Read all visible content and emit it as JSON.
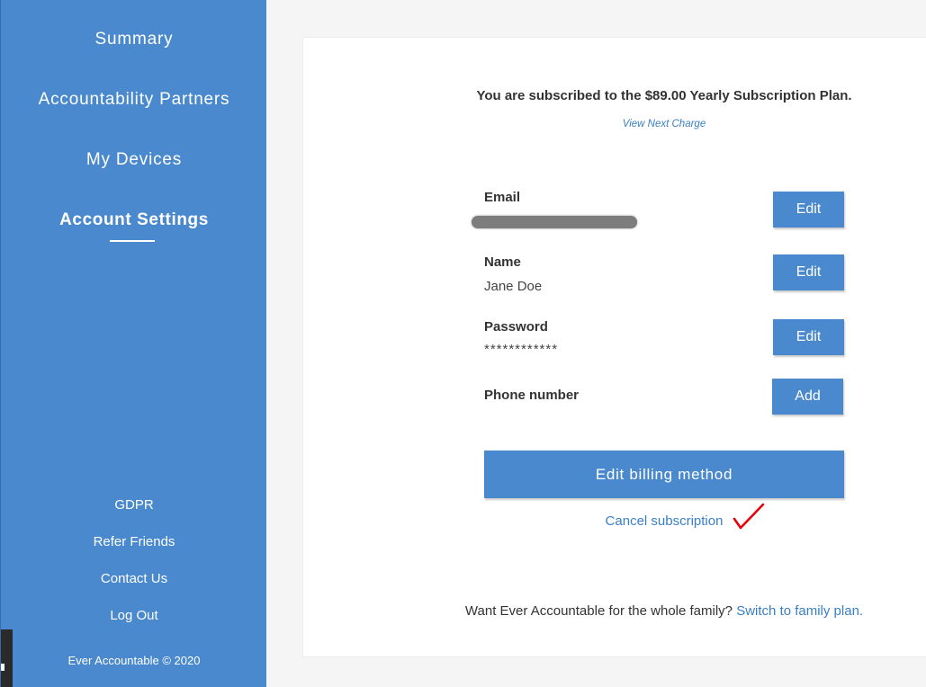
{
  "sidebar": {
    "nav": {
      "summary": "Summary",
      "accountability_partners": "Accountability Partners",
      "my_devices": "My Devices",
      "account_settings": "Account Settings"
    },
    "footer": {
      "gdpr": "GDPR",
      "refer_friends": "Refer Friends",
      "contact_us": "Contact Us",
      "log_out": "Log Out",
      "copyright": "Ever Accountable © 2020"
    }
  },
  "subscription": {
    "title": "You are subscribed to the $89.00 Yearly Subscription Plan.",
    "view_next_charge": "View Next Charge"
  },
  "fields": {
    "email": {
      "label": "Email",
      "button": "Edit"
    },
    "name": {
      "label": "Name",
      "value": "Jane Doe",
      "button": "Edit"
    },
    "password": {
      "label": "Password",
      "value": "************",
      "button": "Edit"
    },
    "phone": {
      "label": "Phone number",
      "button": "Add"
    }
  },
  "billing": {
    "edit_button": "Edit billing method",
    "cancel_link": "Cancel subscription"
  },
  "family": {
    "prompt": "Want Ever Accountable for the whole family?",
    "link": "Switch to family plan."
  },
  "colors": {
    "sidebar_bg": "#4a89cd",
    "button_bg": "#4a89cd",
    "link": "#3a7fc4",
    "annotation_check": "#e8000b"
  },
  "icons": {
    "annotation": "checkmark-icon"
  }
}
